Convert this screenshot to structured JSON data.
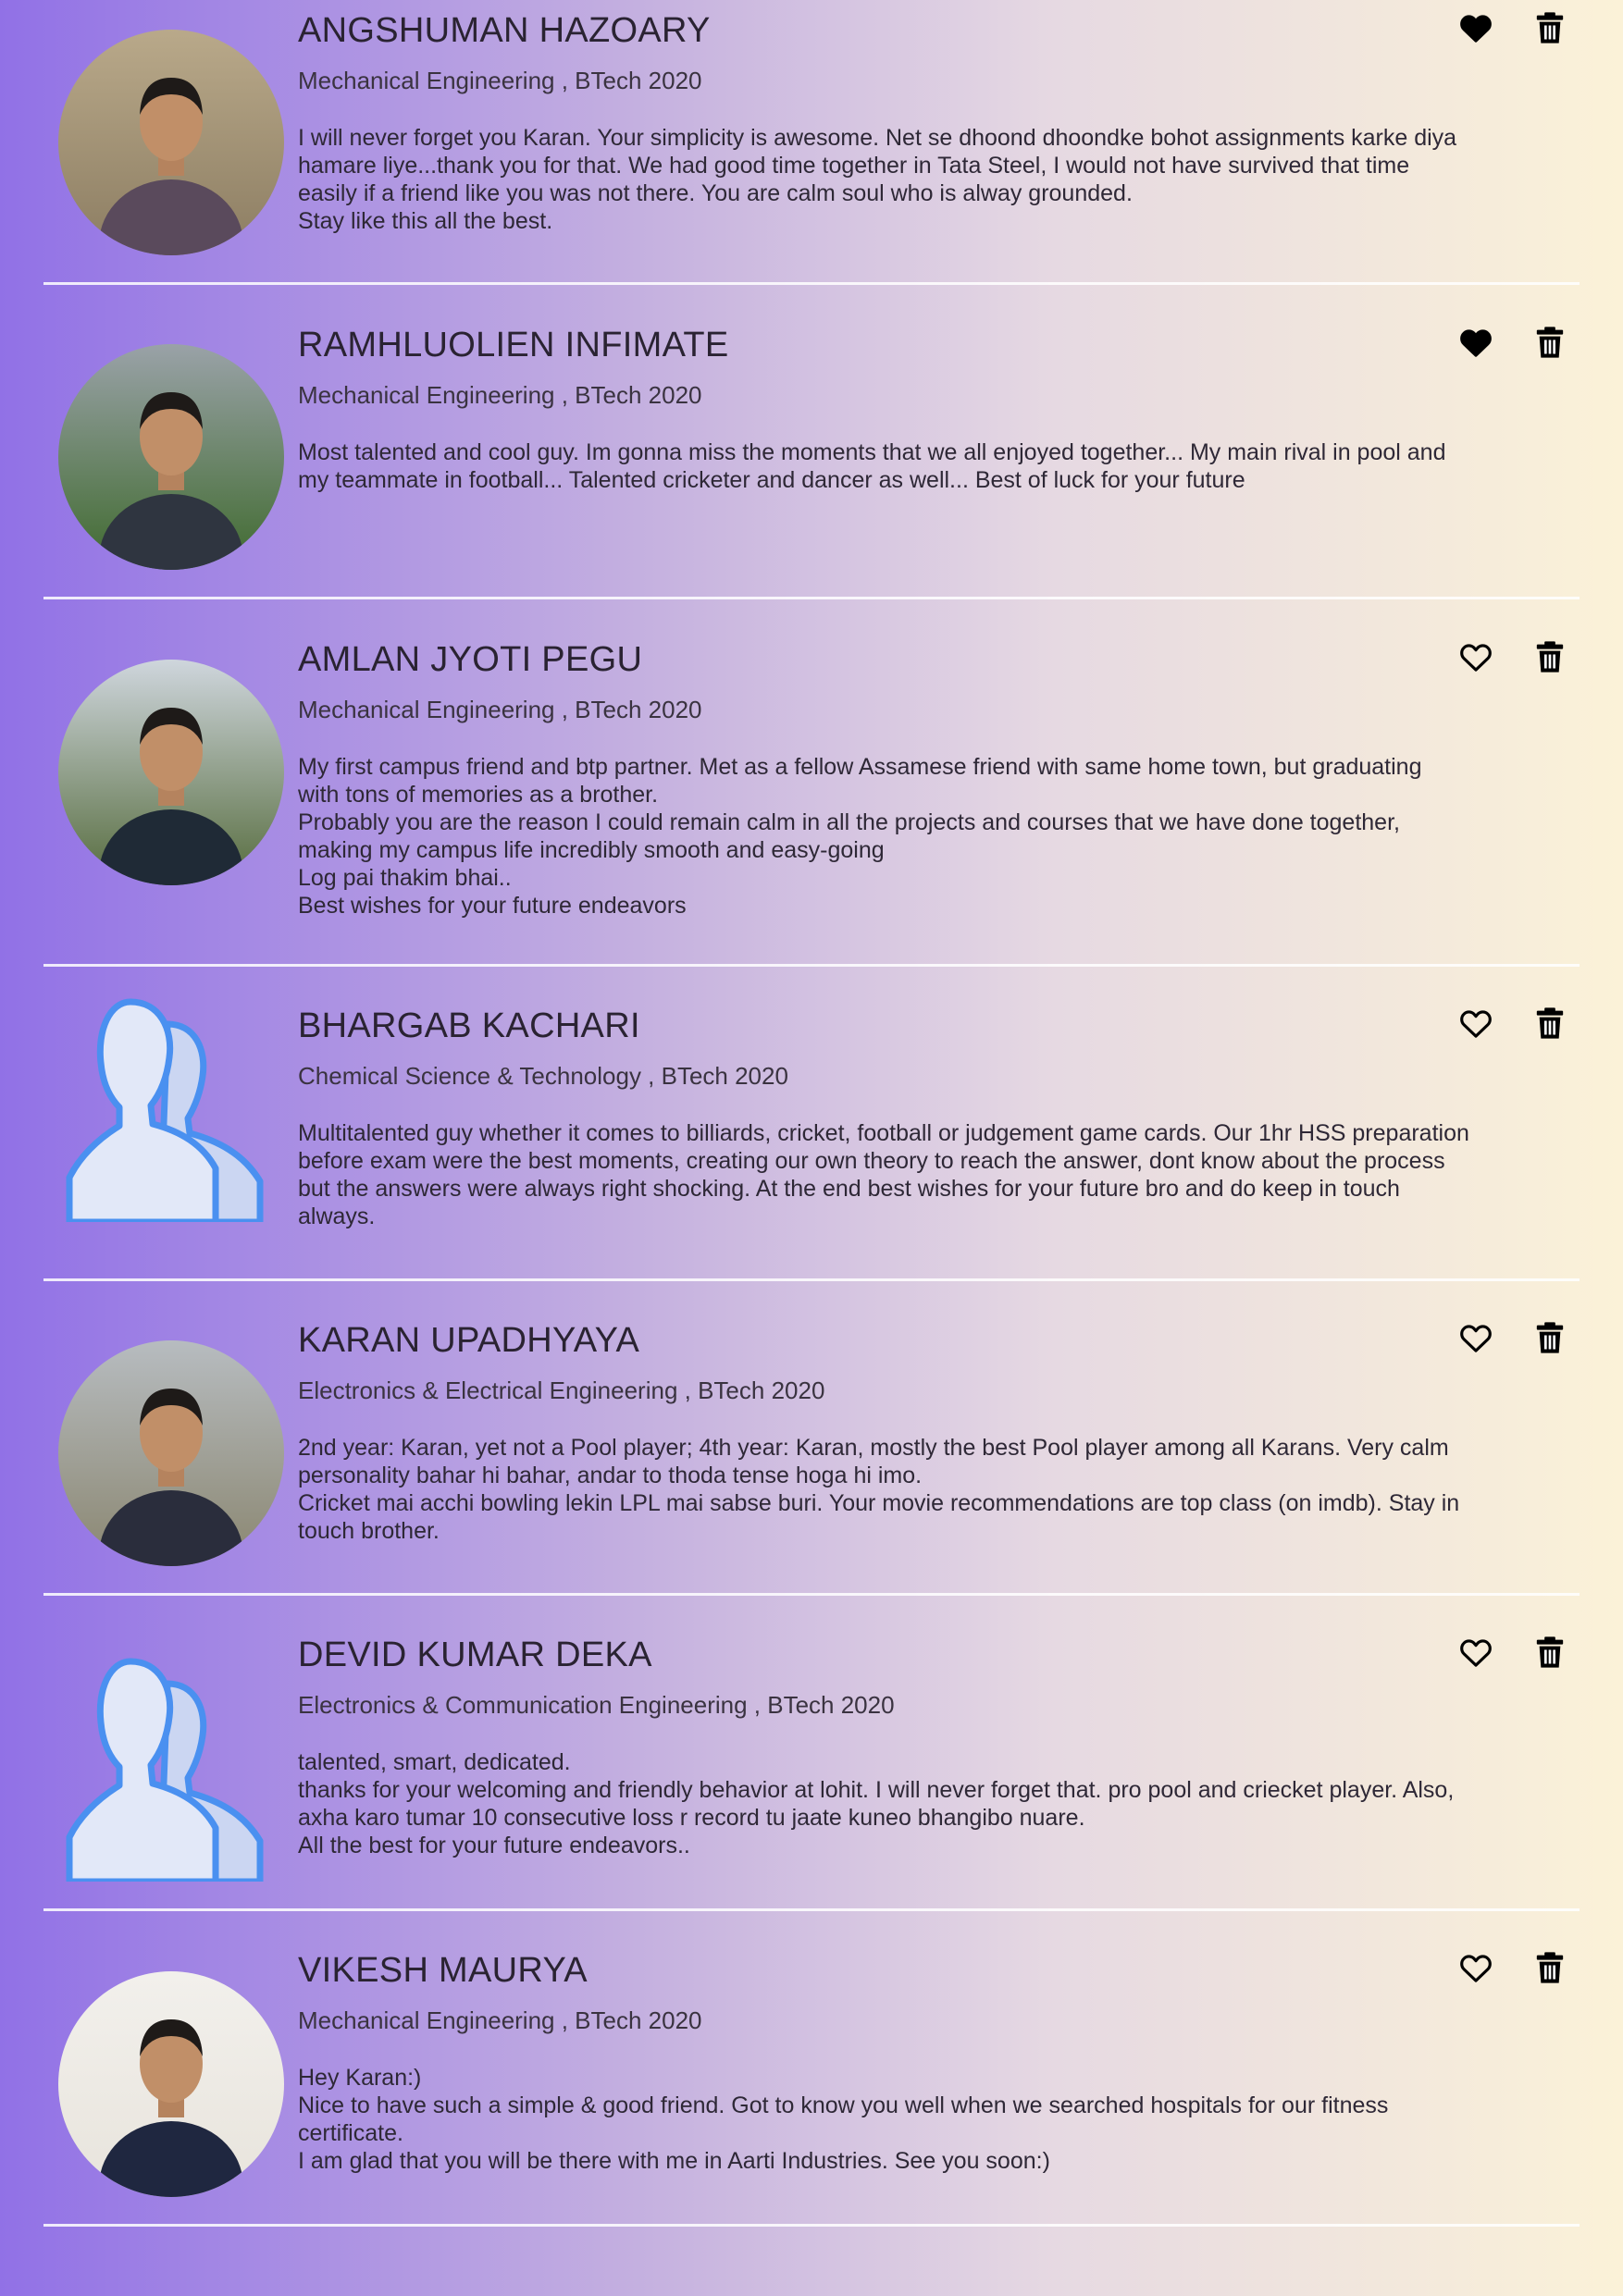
{
  "entries": [
    {
      "name": "ANGSHUMAN HAZOARY",
      "department": "Mechanical Engineering , BTech 2020",
      "liked": true,
      "avatar": "photo",
      "message_lines": [
        "I will never forget you Karan. Your simplicity is awesome. Net se dhoond dhoondke bohot assignments karke diya",
        "hamare liye...thank you for that. We had good time together in Tata Steel, I would not have survived that time",
        "easily if a friend like you was not there. You are calm soul who is alway grounded.",
        "Stay like this all the best."
      ]
    },
    {
      "name": "RAMHLUOLIEN INFIMATE",
      "department": "Mechanical Engineering , BTech 2020",
      "liked": true,
      "avatar": "photo",
      "message_lines": [
        "Most talented and cool guy. Im gonna miss the moments that we all enjoyed together... My main rival in pool and",
        "my teammate in football... Talented cricketer and dancer as well... Best of luck for your future"
      ]
    },
    {
      "name": "AMLAN JYOTI PEGU",
      "department": "Mechanical Engineering , BTech 2020",
      "liked": false,
      "avatar": "photo",
      "message_lines": [
        "My first campus friend and btp partner. Met as a fellow Assamese friend with same home town, but graduating",
        "with tons of memories as a brother.",
        "Probably you are the reason I could remain calm in all the projects and courses that we have done together,",
        "making my campus life incredibly smooth and easy-going",
        "Log pai thakim bhai..",
        "Best wishes for your future endeavors"
      ]
    },
    {
      "name": "BHARGAB KACHARI",
      "department": "Chemical Science & Technology , BTech 2020",
      "liked": false,
      "avatar": "placeholder",
      "message_lines": [
        "Multitalented guy whether it comes to billiards, cricket, football or judgement game cards. Our 1hr HSS preparation",
        "before exam were the best moments, creating our own theory to reach the answer, dont know about the process",
        "but the answers were always right shocking. At the end best wishes for your future bro and do keep in touch",
        "always."
      ]
    },
    {
      "name": "KARAN UPADHYAYA",
      "department": "Electronics & Electrical Engineering , BTech 2020",
      "liked": false,
      "avatar": "photo",
      "message_lines": [
        "2nd year: Karan, yet not a Pool player; 4th year: Karan, mostly the best Pool player among all Karans. Very calm",
        "personality bahar hi bahar, andar to thoda tense hoga hi imo.",
        "Cricket mai acchi bowling lekin LPL mai sabse buri. Your movie recommendations are top class (on imdb). Stay in",
        "touch brother."
      ]
    },
    {
      "name": "DEVID KUMAR DEKA",
      "department": "Electronics & Communication Engineering , BTech 2020",
      "liked": false,
      "avatar": "placeholder",
      "message_lines": [
        "talented, smart, dedicated.",
        "thanks for your welcoming and friendly behavior at lohit. I will never forget that. pro pool and criecket player. Also,",
        "axha karo tumar 10 consecutive loss r record tu jaate kuneo bhangibo nuare.",
        "All the best for your future endeavors.."
      ]
    },
    {
      "name": "VIKESH MAURYA",
      "department": "Mechanical Engineering , BTech 2020",
      "liked": false,
      "avatar": "photo",
      "message_lines": [
        "Hey Karan:)",
        "Nice to have such a simple & good friend. Got to know you well when we searched hospitals for our fitness",
        "certificate.",
        "I am glad that you will be there with me in Aarti Industries. See you soon:)"
      ]
    }
  ],
  "colors": {
    "gradient_left": "#9171e6",
    "gradient_right": "#fbf2d8",
    "divider": "#ffffff",
    "icon": "#000000",
    "placeholder_avatar_blue": "#4a90f0"
  }
}
